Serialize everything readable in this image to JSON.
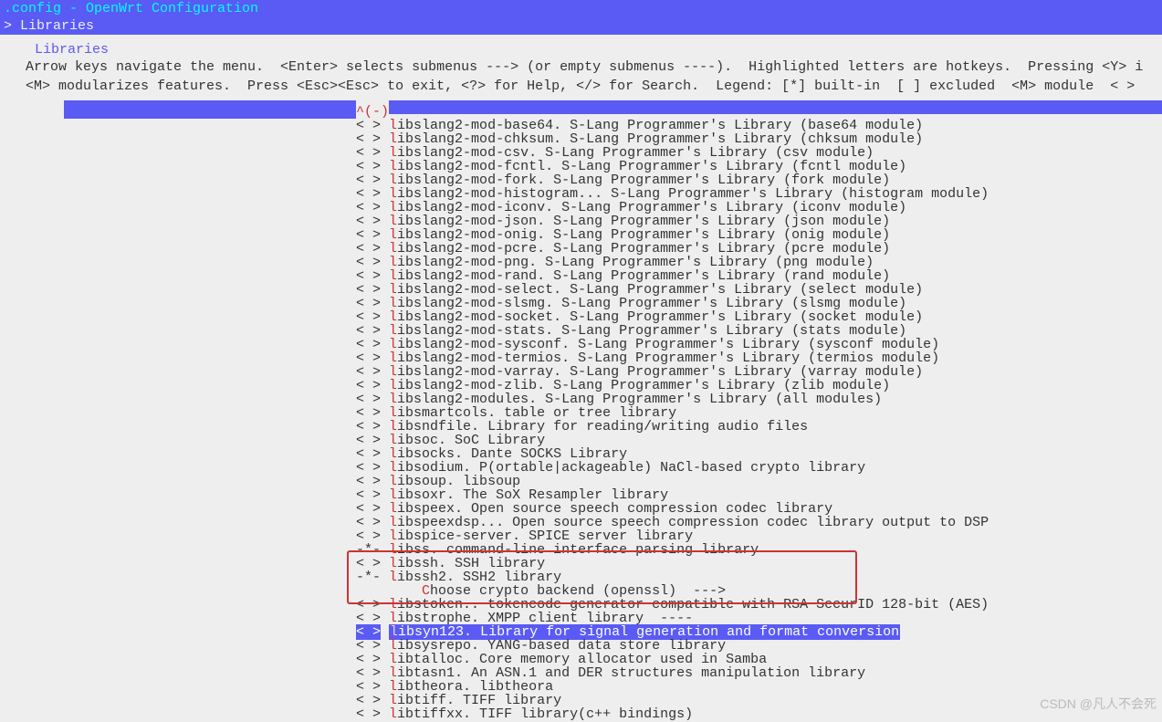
{
  "title": ".config - OpenWrt Configuration",
  "breadcrumb": "> Libraries",
  "menu_label": "Libraries",
  "help_line1": "Arrow keys navigate the menu.  <Enter> selects submenus ---> (or empty submenus ----).  Highlighted letters are hotkeys.  Pressing <Y> includes, <N> exclud",
  "help_line2": "<M> modularizes features.  Press <Esc><Esc> to exit, <?> for Help, </> for Search.  Legend: [*] built-in  [ ] excluded  <M> module  < > module capable │",
  "scroll_hint": "^(-)",
  "items": [
    {
      "mark": "< >",
      "hot": "l",
      "rest": "ibslang2-mod-base64. S-Lang Programmer's Library (base64 module)"
    },
    {
      "mark": "< >",
      "hot": "l",
      "rest": "ibslang2-mod-chksum. S-Lang Programmer's Library (chksum module)"
    },
    {
      "mark": "< >",
      "hot": "l",
      "rest": "ibslang2-mod-csv. S-Lang Programmer's Library (csv module)"
    },
    {
      "mark": "< >",
      "hot": "l",
      "rest": "ibslang2-mod-fcntl. S-Lang Programmer's Library (fcntl module)"
    },
    {
      "mark": "< >",
      "hot": "l",
      "rest": "ibslang2-mod-fork. S-Lang Programmer's Library (fork module)"
    },
    {
      "mark": "< >",
      "hot": "l",
      "rest": "ibslang2-mod-histogram... S-Lang Programmer's Library (histogram module)"
    },
    {
      "mark": "< >",
      "hot": "l",
      "rest": "ibslang2-mod-iconv. S-Lang Programmer's Library (iconv module)"
    },
    {
      "mark": "< >",
      "hot": "l",
      "rest": "ibslang2-mod-json. S-Lang Programmer's Library (json module)"
    },
    {
      "mark": "< >",
      "hot": "l",
      "rest": "ibslang2-mod-onig. S-Lang Programmer's Library (onig module)"
    },
    {
      "mark": "< >",
      "hot": "l",
      "rest": "ibslang2-mod-pcre. S-Lang Programmer's Library (pcre module)"
    },
    {
      "mark": "< >",
      "hot": "l",
      "rest": "ibslang2-mod-png. S-Lang Programmer's Library (png module)"
    },
    {
      "mark": "< >",
      "hot": "l",
      "rest": "ibslang2-mod-rand. S-Lang Programmer's Library (rand module)"
    },
    {
      "mark": "< >",
      "hot": "l",
      "rest": "ibslang2-mod-select. S-Lang Programmer's Library (select module)"
    },
    {
      "mark": "< >",
      "hot": "l",
      "rest": "ibslang2-mod-slsmg. S-Lang Programmer's Library (slsmg module)"
    },
    {
      "mark": "< >",
      "hot": "l",
      "rest": "ibslang2-mod-socket. S-Lang Programmer's Library (socket module)"
    },
    {
      "mark": "< >",
      "hot": "l",
      "rest": "ibslang2-mod-stats. S-Lang Programmer's Library (stats module)"
    },
    {
      "mark": "< >",
      "hot": "l",
      "rest": "ibslang2-mod-sysconf. S-Lang Programmer's Library (sysconf module)"
    },
    {
      "mark": "< >",
      "hot": "l",
      "rest": "ibslang2-mod-termios. S-Lang Programmer's Library (termios module)"
    },
    {
      "mark": "< >",
      "hot": "l",
      "rest": "ibslang2-mod-varray. S-Lang Programmer's Library (varray module)"
    },
    {
      "mark": "< >",
      "hot": "l",
      "rest": "ibslang2-mod-zlib. S-Lang Programmer's Library (zlib module)"
    },
    {
      "mark": "< >",
      "hot": "l",
      "rest": "ibslang2-modules. S-Lang Programmer's Library (all modules)"
    },
    {
      "mark": "< >",
      "hot": "l",
      "rest": "ibsmartcols. table or tree library"
    },
    {
      "mark": "< >",
      "hot": "l",
      "rest": "ibsndfile. Library for reading/writing audio files"
    },
    {
      "mark": "< >",
      "hot": "l",
      "rest": "ibsoc. SoC Library"
    },
    {
      "mark": "< >",
      "hot": "l",
      "rest": "ibsocks. Dante SOCKS Library"
    },
    {
      "mark": "< >",
      "hot": "l",
      "rest": "ibsodium. P(ortable|ackageable) NaCl-based crypto library"
    },
    {
      "mark": "< >",
      "hot": "l",
      "rest": "ibsoup. libsoup"
    },
    {
      "mark": "< >",
      "hot": "l",
      "rest": "ibsoxr. The SoX Resampler library"
    },
    {
      "mark": "< >",
      "hot": "l",
      "rest": "ibspeex. Open source speech compression codec library"
    },
    {
      "mark": "< >",
      "hot": "l",
      "rest": "ibspeexdsp... Open source speech compression codec library output to DSP"
    },
    {
      "mark": "< >",
      "hot": "l",
      "rest": "ibspice-server. SPICE server library"
    },
    {
      "mark": "-*-",
      "hot": "l",
      "rest": "ibss. command-line interface parsing library"
    },
    {
      "mark": "< >",
      "hot": "l",
      "rest": "ibssh. SSH library"
    },
    {
      "mark": "-*-",
      "hot": "l",
      "rest": "ibssh2. SSH2 library"
    },
    {
      "mark": "   ",
      "hot": "C",
      "rest": "hoose crypto backend (openssl)  --->",
      "indent": "    "
    },
    {
      "mark": "< >",
      "hot": "l",
      "rest": "ibstoken.. tokencode generator compatible with RSA SecurID 128-bit (AES)"
    },
    {
      "mark": "< >",
      "hot": "l",
      "rest": "ibstrophe. XMPP client library  ----"
    },
    {
      "mark": "< >",
      "hot": "l",
      "rest": "ibsyn123. Library for signal generation and format conversion",
      "selected": true
    },
    {
      "mark": "< >",
      "hot": "l",
      "rest": "ibsysrepo. YANG-based data store library"
    },
    {
      "mark": "< >",
      "hot": "l",
      "rest": "ibtalloc. Core memory allocator used in Samba"
    },
    {
      "mark": "< >",
      "hot": "l",
      "rest": "ibtasn1. An ASN.1 and DER structures manipulation library"
    },
    {
      "mark": "< >",
      "hot": "l",
      "rest": "ibtheora. libtheora"
    },
    {
      "mark": "< >",
      "hot": "l",
      "rest": "ibtiff. TIFF library"
    },
    {
      "mark": "< >",
      "hot": "l",
      "rest": "ibtiffxx. TIFF library(c++ bindings)"
    }
  ],
  "watermark_left": "CSDN",
  "watermark_right": "@凡人不会死"
}
